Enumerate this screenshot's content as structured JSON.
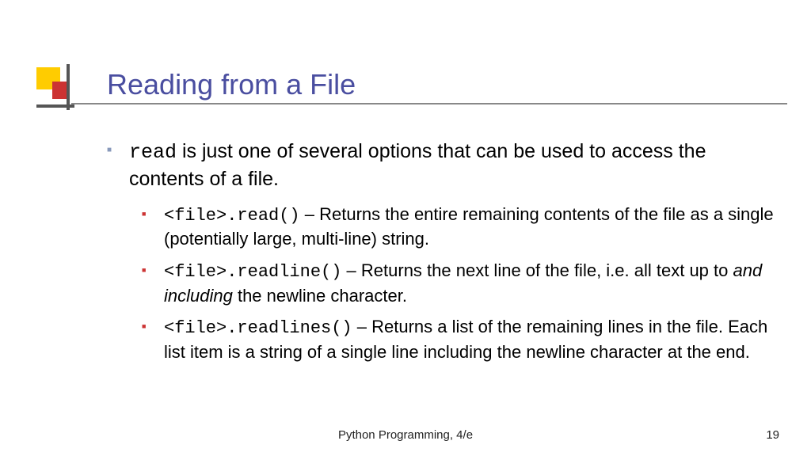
{
  "title": "Reading from a File",
  "bullet": {
    "code": "read",
    "text_after": " is just one of several options that can be used to access the contents of a file."
  },
  "sub1": {
    "code": "<file>.read()",
    "text": " – Returns the entire remaining contents of the file as a single (potentially large, multi-line) string."
  },
  "sub2": {
    "code": "<file>.readline()",
    "text_a": " – Returns the next line of the file, i.e. all text up to ",
    "italic": "and including",
    "text_b": " the newline character."
  },
  "sub3": {
    "code": "<file>.readlines()",
    "text": " – Returns a list of the remaining lines in the file. Each list item is a string of a single line including the newline character at the end."
  },
  "footer_center": "Python Programming, 4/e",
  "footer_right": "19"
}
